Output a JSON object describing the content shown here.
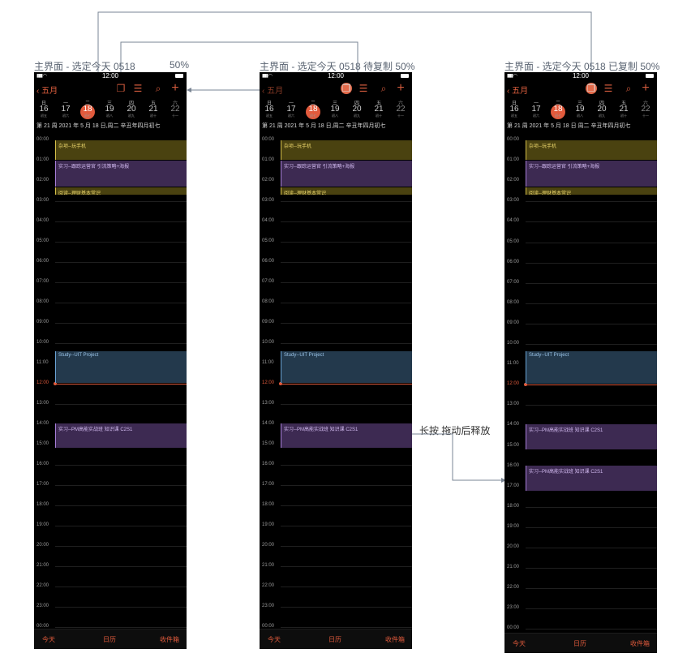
{
  "annotations": {
    "left_title": "主界面 - 选定今天 0518",
    "left_percent": "50%",
    "mid_title": "主界面 - 选定今天 0518 待复制 50%",
    "right_title": "主界面 - 选定今天 0518 已复制 50%",
    "gesture": "长按 拖动后释放"
  },
  "status": {
    "time": "12:00",
    "signal": "▮▮▮ ◠"
  },
  "nav": {
    "back_label": "五月"
  },
  "week": {
    "weekday_labels": [
      "日",
      "一",
      "二",
      "三",
      "四",
      "五",
      "六"
    ],
    "days": [
      {
        "num": "16",
        "lunar": "初五"
      },
      {
        "num": "17",
        "lunar": "初六"
      },
      {
        "num": "18",
        "lunar": "初七"
      },
      {
        "num": "19",
        "lunar": "初八"
      },
      {
        "num": "20",
        "lunar": "初九"
      },
      {
        "num": "21",
        "lunar": "初十"
      },
      {
        "num": "22",
        "lunar": "十一"
      }
    ],
    "selected_index": 2
  },
  "info_left": "第 21 周   2021 年 5 月 18 日,周二 辛丑年四月初七",
  "info_mid": "第 21 周   2021 年 5 月 18 日,周二 辛丑年四月初七",
  "info_right": "第 21 周   2021 年 5 月 18 日 周二 辛丑年四月初七",
  "hours": [
    "00:00",
    "01:00",
    "02:00",
    "03:00",
    "04:00",
    "05:00",
    "06:00",
    "07:00",
    "08:00",
    "09:00",
    "10:00",
    "11:00",
    "12:00",
    "13:00",
    "14:00",
    "15:00",
    "16:00",
    "17:00",
    "18:00",
    "19:00",
    "20:00",
    "21:00",
    "22:00",
    "23:00",
    "00:00"
  ],
  "events": {
    "e1": "杂项--玩手机",
    "e1_right": "杂项--玩手机",
    "e2": "实习--跟踪运营官 引流策略+海报",
    "e2_right": "实习--跟踪运营官 引流策略+海报",
    "e3": "阅读--理财基本常识",
    "e3_right": "阅读--理财基本常识",
    "e4": "Study--UIT Project",
    "e5": "实习--PM高能实战班 知识课 C2S1",
    "e5_right": "实习--PM高能实战班 知识课 C2S1",
    "e6_copy": "实习--PM高能实战班 知识课 C2S1"
  },
  "tabs": {
    "today": "今天",
    "calendar": "日历",
    "inbox": "收件箱"
  },
  "colors": {
    "accent": "#e05a3c",
    "yellow_event": "#4a4210",
    "purple_event": "#3d2a52",
    "blue_event": "#23394c",
    "connector": "#7a8594"
  }
}
